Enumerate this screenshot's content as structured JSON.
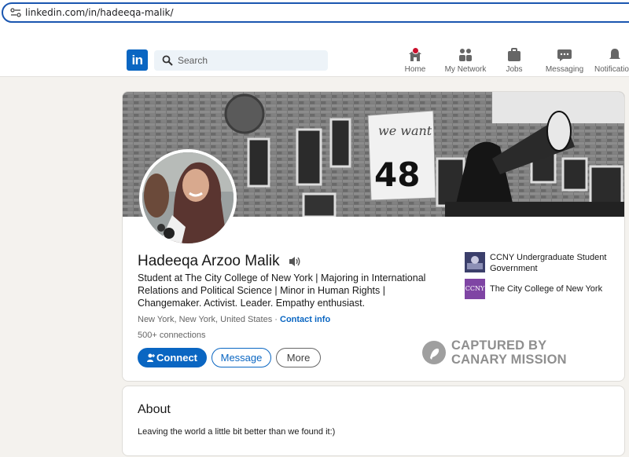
{
  "browser": {
    "url": "linkedin.com/in/hadeeqa-malik/"
  },
  "nav": {
    "logo": "in",
    "search_placeholder": "Search",
    "items": [
      {
        "label": "Home",
        "icon": "home-icon"
      },
      {
        "label": "My Network",
        "icon": "network-icon"
      },
      {
        "label": "Jobs",
        "icon": "briefcase-icon"
      },
      {
        "label": "Messaging",
        "icon": "messaging-icon"
      },
      {
        "label": "Notifications",
        "icon": "bell-icon"
      }
    ]
  },
  "profile": {
    "cover_sign_top": "we want",
    "cover_sign_number": "48",
    "name": "Hadeeqa Arzoo Malik",
    "headline": "Student at The City College of New York | Majoring in International Relations and Political Science | Minor in Human Rights | Changemaker. Activist. Leader. Empathy enthusiast.",
    "location": "New York, New York, United States",
    "separator": " · ",
    "contact_label": "Contact info",
    "connections": "500+ connections",
    "buttons": {
      "connect": "Connect",
      "message": "Message",
      "more": "More"
    },
    "orgs": [
      {
        "name": "CCNY Undergraduate Student Government",
        "logo_text": ""
      },
      {
        "name": "The City College of New York",
        "logo_text": "CCNY"
      }
    ]
  },
  "watermark": {
    "line1": "CAPTURED BY",
    "line2": "CANARY MISSION"
  },
  "about": {
    "title": "About",
    "text": "Leaving the world a little bit better than we found it:)"
  },
  "colors": {
    "brand": "#0a66c2",
    "notification": "#cb112d",
    "page_bg": "#f4f2ee"
  }
}
